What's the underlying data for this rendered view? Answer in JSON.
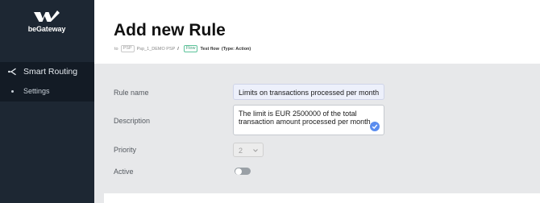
{
  "brand": {
    "name": "beGateway"
  },
  "nav": {
    "section": {
      "label": "Smart Routing",
      "icon": "routing-icon"
    },
    "sub_item": {
      "label": "Settings"
    }
  },
  "header": {
    "title": "Add new Rule",
    "breadcrumb": {
      "prefix": "to",
      "psp_tag": "PSP",
      "psp_name": "Psp_1_DEMO PSP",
      "separator": "/",
      "flow_tag": "Flow",
      "flow_name": "Test flow",
      "flow_type": "(Type: Action)"
    }
  },
  "form": {
    "rule_name": {
      "label": "Rule name",
      "value": "Limits on transactions processed per month"
    },
    "description": {
      "label": "Description",
      "value": "The limit is EUR 2500000 of the total transaction amount processed per month."
    },
    "priority": {
      "label": "Priority",
      "value": "2"
    },
    "active": {
      "label": "Active",
      "enabled": false
    }
  },
  "colors": {
    "sidebar_bg": "#1d2733",
    "nav_active_bg": "#131b25",
    "content_bg": "#e7e8ea",
    "accent": "#5b8def",
    "flow_tag": "#5cc39a"
  }
}
